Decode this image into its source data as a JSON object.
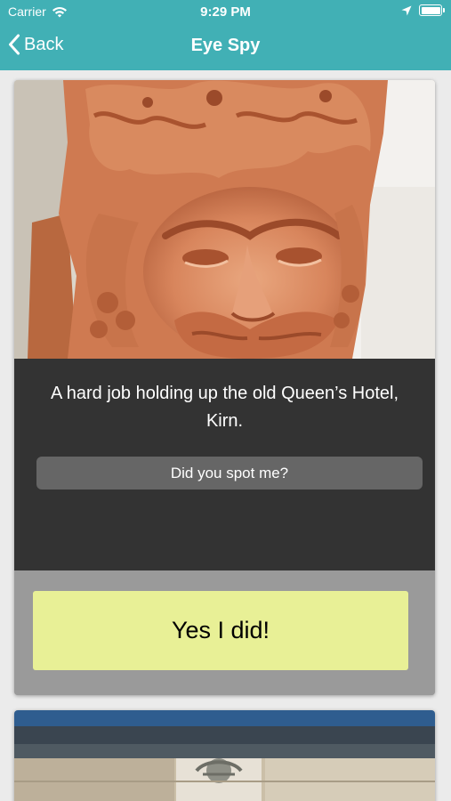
{
  "status": {
    "carrier": "Carrier",
    "time": "9:29 PM",
    "icons": [
      "wifi-icon",
      "location-arrow-icon",
      "battery-icon"
    ]
  },
  "nav": {
    "back_label": "Back",
    "back_icon": "chevron-left-icon",
    "title": "Eye Spy"
  },
  "colors": {
    "header": "#41b0b5",
    "caption_bg": "#333333",
    "spot_button": "#666666",
    "answer_bg": "#9a9a9a",
    "yes_button": "#e8f096"
  },
  "card": {
    "photo": "terracotta-green-man-carving",
    "caption": "A hard job holding up the old Queen’s Hotel, Kirn.",
    "spot_label": "Did you spot me?",
    "yes_label": "Yes I did!"
  },
  "next_card": {
    "photo": "stone-building-cornice-carving"
  }
}
